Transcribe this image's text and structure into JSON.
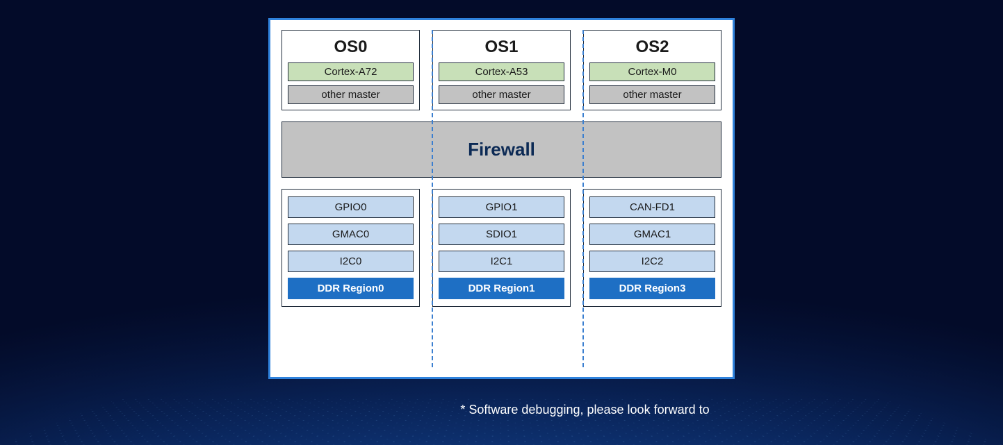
{
  "diagram": {
    "os_columns": [
      {
        "os_title": "OS0",
        "cpu": "Cortex-A72",
        "other": "other master"
      },
      {
        "os_title": "OS1",
        "cpu": "Cortex-A53",
        "other": "other master"
      },
      {
        "os_title": "OS2",
        "cpu": "Cortex-M0",
        "other": "other master"
      }
    ],
    "firewall_label": "Firewall",
    "periph_columns": [
      {
        "items": [
          "GPIO0",
          "GMAC0",
          "I2C0"
        ],
        "ddr": "DDR Region0"
      },
      {
        "items": [
          "GPIO1",
          "SDIO1",
          "I2C1"
        ],
        "ddr": "DDR Region1"
      },
      {
        "items": [
          "CAN-FD1",
          "GMAC1",
          "I2C2"
        ],
        "ddr": "DDR Region3"
      }
    ]
  },
  "footnote": "* Software debugging, please look forward to"
}
